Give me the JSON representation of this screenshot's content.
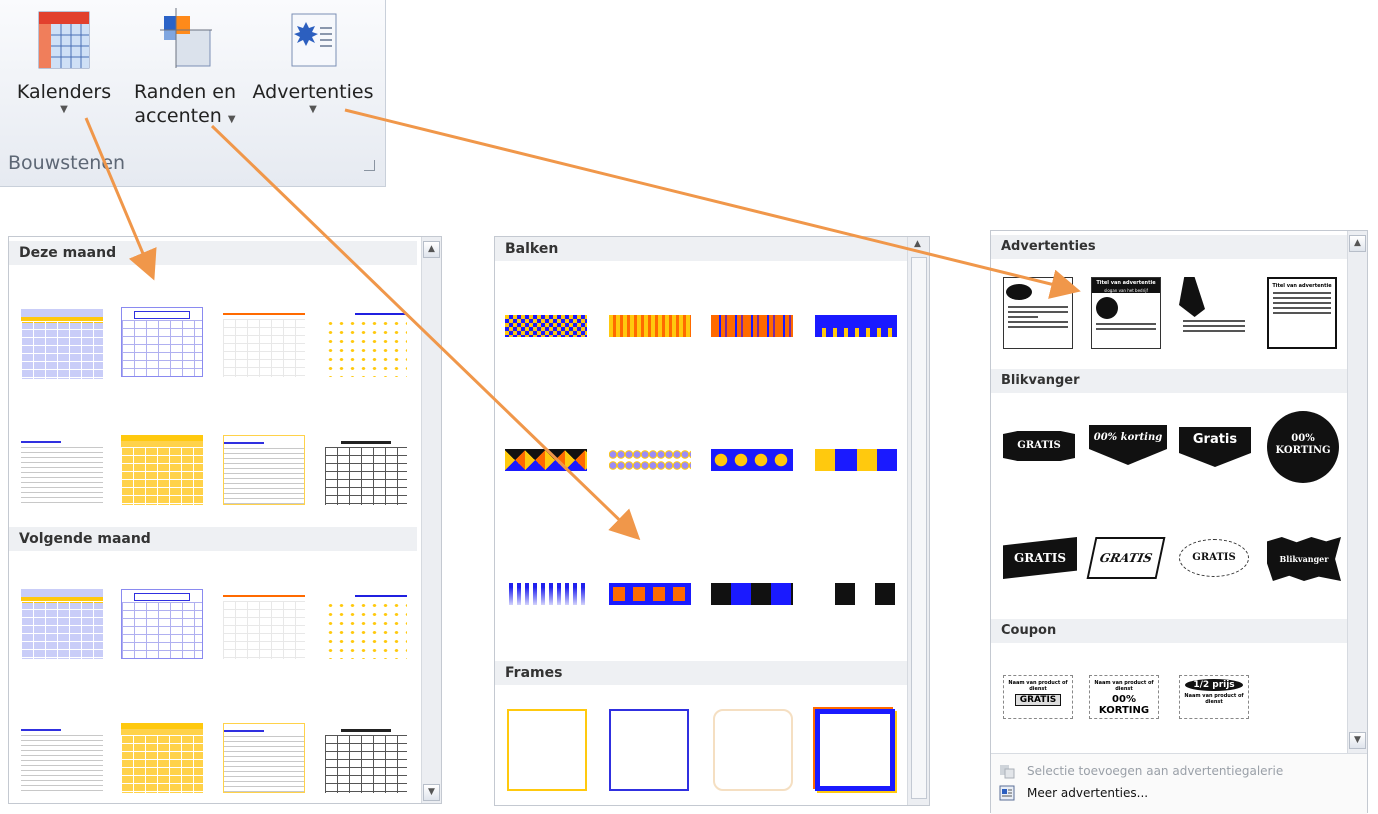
{
  "ribbon": {
    "buttons": [
      {
        "line1": "Kalenders",
        "line2": ""
      },
      {
        "line1": "Randen en",
        "line2": "accenten"
      },
      {
        "line1": "Advertenties",
        "line2": ""
      }
    ],
    "group_label": "Bouwstenen"
  },
  "calendars": {
    "sections": [
      "Deze maand",
      "Volgende maand"
    ]
  },
  "borders": {
    "sections": [
      "Balken",
      "Frames"
    ]
  },
  "ads": {
    "sections": [
      "Advertenties",
      "Blikvanger",
      "Coupon"
    ],
    "ad_thumbs": [
      {
        "title": "",
        "sub": ""
      },
      {
        "title": "Titel van advertentie",
        "sub": "slogan van het bedrijf"
      },
      {
        "title": "",
        "sub": ""
      },
      {
        "title": "Titel van advertentie",
        "sub": ""
      }
    ],
    "eye_catchers": [
      "GRATIS",
      "00% korting",
      "Gratis",
      "00% KORTING",
      "GRATIS",
      "GRATIS",
      "GRATIS",
      "Blikvanger"
    ],
    "coupons": [
      {
        "line1": "Naam van product of dienst",
        "line2": "GRATIS"
      },
      {
        "line1": "Naam van product of dienst",
        "line2": "00% KORTING"
      },
      {
        "line1": "1/2 prijs",
        "line2": "Naam van product of dienst"
      }
    ],
    "menu": [
      {
        "label": "Selectie toevoegen aan advertentiegalerie",
        "enabled": false
      },
      {
        "label": "Meer advertenties...",
        "enabled": true
      }
    ]
  },
  "colors": {
    "arrow": "#f0974a",
    "blue": "#1a1aff",
    "yellow": "#ffc90e",
    "orange": "#ff6a00"
  }
}
